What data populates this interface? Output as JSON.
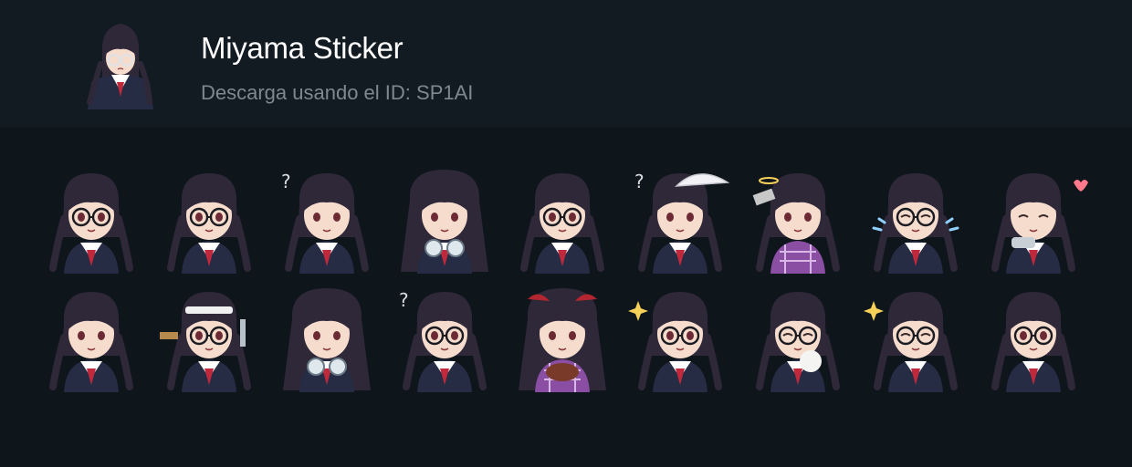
{
  "pack": {
    "title": "Miyama Sticker",
    "subtitle": "Descarga usando el ID: SP1AI"
  },
  "colors": {
    "page_background": "#0e151b",
    "header_background": "#131b22",
    "title_text": "#ffffff",
    "subtitle_text": "#7e8891",
    "hair": "#2e2838",
    "skin": "#f6dccd",
    "uniform": "#262c44",
    "scarf": "#c0283c"
  },
  "stickers": [
    {
      "name": "sticker-1",
      "variant": "glasses"
    },
    {
      "name": "sticker-2",
      "variant": "arms-up"
    },
    {
      "name": "sticker-3",
      "variant": "question"
    },
    {
      "name": "sticker-4",
      "variant": "long-hair-binoculars"
    },
    {
      "name": "sticker-5",
      "variant": "glasses-shocked"
    },
    {
      "name": "sticker-6",
      "variant": "umbrella-kimono"
    },
    {
      "name": "sticker-7",
      "variant": "kimono-angel-phone"
    },
    {
      "name": "sticker-8",
      "variant": "crying"
    },
    {
      "name": "sticker-9",
      "variant": "heart-drink"
    },
    {
      "name": "sticker-10",
      "variant": "pouting"
    },
    {
      "name": "sticker-11",
      "variant": "headband-tools"
    },
    {
      "name": "sticker-12",
      "variant": "long-hair-binoculars"
    },
    {
      "name": "sticker-13",
      "variant": "goggles-confused"
    },
    {
      "name": "sticker-14",
      "variant": "kimono-food"
    },
    {
      "name": "sticker-15",
      "variant": "glasses-glint"
    },
    {
      "name": "sticker-16",
      "variant": "eating"
    },
    {
      "name": "sticker-17",
      "variant": "sparkle-happy"
    },
    {
      "name": "sticker-18",
      "variant": "waving"
    }
  ]
}
